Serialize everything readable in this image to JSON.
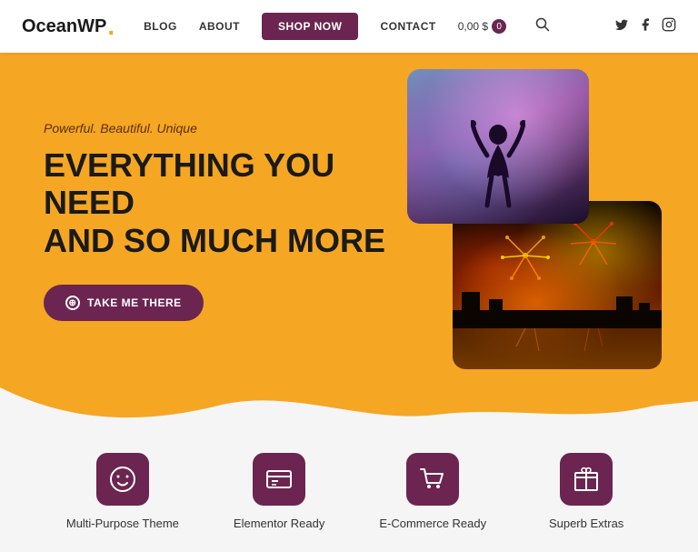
{
  "navbar": {
    "logo": "OceanWP",
    "logo_dot": ".",
    "blog_label": "BLOG",
    "about_label": "ABOUT",
    "shop_now_label": "SHOP NOW",
    "contact_label": "CONTACT",
    "cart_price": "0,00 $",
    "cart_count": "0",
    "search_icon": "🔍"
  },
  "social": {
    "twitter_icon": "𝕏",
    "facebook_icon": "f",
    "instagram_icon": "📷"
  },
  "hero": {
    "subtitle": "Powerful. Beautiful. Unique",
    "title_line1": "EVERYTHING YOU NEED",
    "title_line2": "AND SO MUCH MORE",
    "button_label": "TAKE ME THERE"
  },
  "features": [
    {
      "label": "Multi-Purpose Theme",
      "icon": "😊"
    },
    {
      "label": "Elementor Ready",
      "icon": "🪪"
    },
    {
      "label": "E-Commerce Ready",
      "icon": "🛒"
    },
    {
      "label": "Superb Extras",
      "icon": "🎁"
    }
  ]
}
